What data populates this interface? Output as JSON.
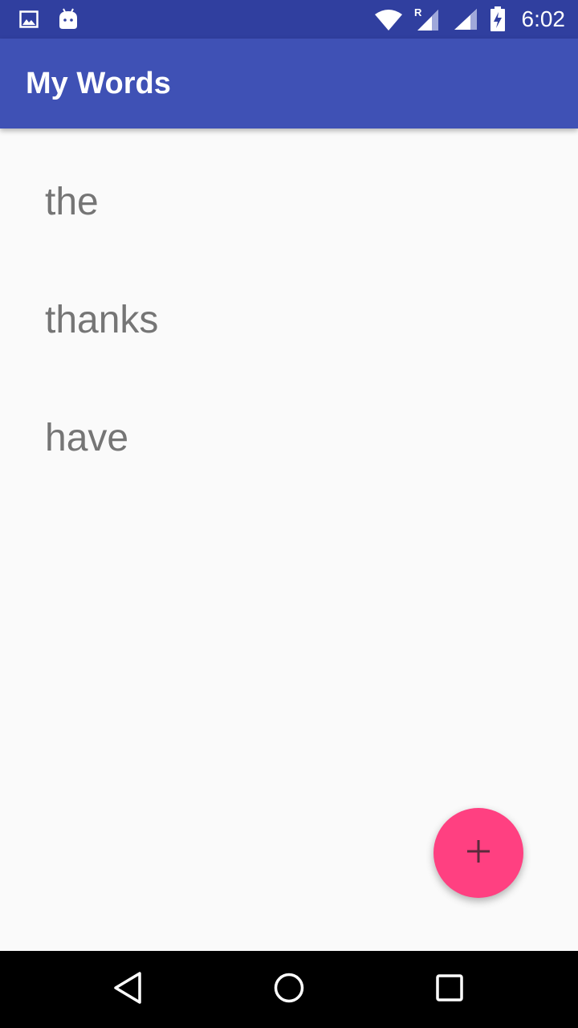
{
  "status_bar": {
    "time": "6:02",
    "background": "#303f9f",
    "left_icons": [
      "image-icon",
      "android-icon"
    ],
    "right_icons": [
      "wifi-icon",
      "cell-signal-roaming-icon",
      "cell-signal-icon",
      "battery-charging-icon"
    ],
    "roaming_label": "R"
  },
  "app_bar": {
    "title": "My Words",
    "background": "#3f51b5"
  },
  "words": [
    "the",
    "thanks",
    "have"
  ],
  "fab": {
    "icon": "plus-icon",
    "color": "#ff4081"
  },
  "nav_bar": {
    "buttons": [
      "back-icon",
      "home-icon",
      "recents-icon"
    ]
  }
}
